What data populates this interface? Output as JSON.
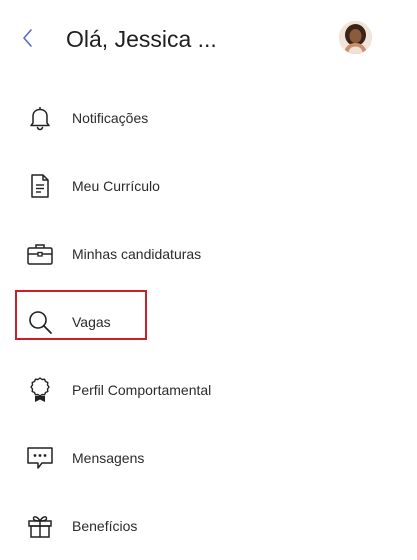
{
  "header": {
    "back_icon": "chevron-left-icon",
    "greeting": "Olá, Jessica ...",
    "avatar_icon": "user-avatar"
  },
  "menu": {
    "items": [
      {
        "label": "Notificações",
        "icon": "bell-icon"
      },
      {
        "label": "Meu Currículo",
        "icon": "document-icon"
      },
      {
        "label": "Minhas candidaturas",
        "icon": "briefcase-icon"
      },
      {
        "label": "Vagas",
        "icon": "search-icon",
        "highlighted": true
      },
      {
        "label": "Perfil Comportamental",
        "icon": "award-icon"
      },
      {
        "label": "Mensagens",
        "icon": "message-icon"
      },
      {
        "label": "Benefícios",
        "icon": "gift-icon"
      }
    ]
  },
  "colors": {
    "accent": "#3f51b5",
    "text": "#2b2b2b",
    "highlight_border": "#c8202f"
  }
}
